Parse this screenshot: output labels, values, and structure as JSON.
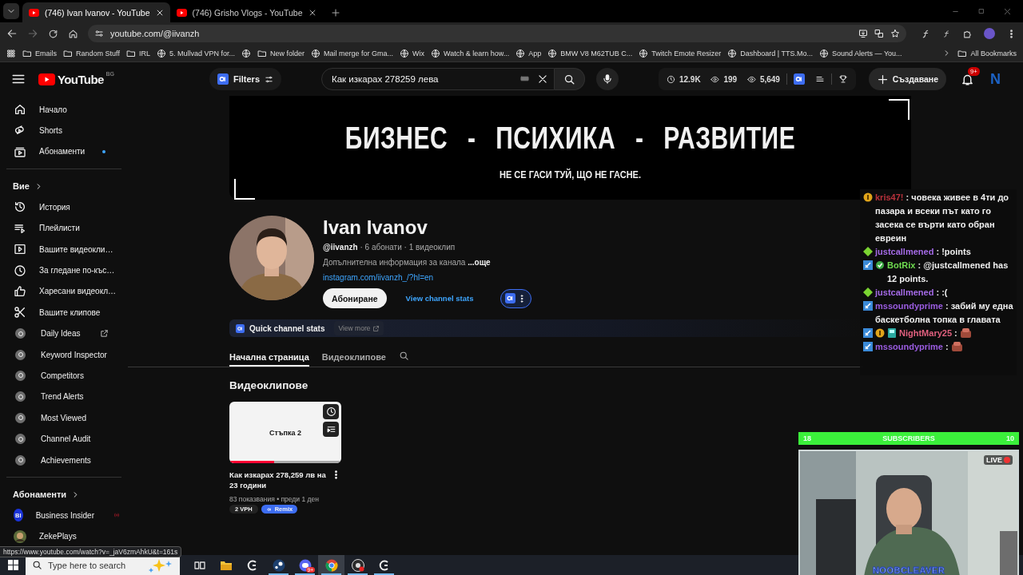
{
  "browser": {
    "tabs": [
      {
        "title": "(746) Ivan Ivanov - YouTube",
        "selected": true
      },
      {
        "title": "(746) Grisho Vlogs - YouTube",
        "selected": false
      }
    ],
    "url": "youtube.com/@iivanzh",
    "bookmarks": [
      {
        "kind": "folder",
        "label": "Emails"
      },
      {
        "kind": "folder",
        "label": "Random Stuff"
      },
      {
        "kind": "folder",
        "label": "IRL"
      },
      {
        "kind": "site",
        "label": "5. Mullvad VPN for..."
      },
      {
        "kind": "site"
      },
      {
        "kind": "folder",
        "label": "New folder"
      },
      {
        "kind": "site",
        "label": "Mail merge for Gma..."
      },
      {
        "kind": "site",
        "label": "Wix"
      },
      {
        "kind": "site",
        "label": "Watch & learn how..."
      },
      {
        "kind": "site",
        "label": "App"
      },
      {
        "kind": "site",
        "label": "BMW V8 M62TUB C..."
      },
      {
        "kind": "site",
        "label": "Twitch Emote Resizer"
      },
      {
        "kind": "site",
        "label": "Dashboard | TTS.Mo..."
      },
      {
        "kind": "site",
        "label": "Sound Alerts — You..."
      }
    ],
    "all_bookmarks": "All Bookmarks"
  },
  "header": {
    "logo": "YouTube",
    "region": "BG",
    "filters": "Filters",
    "search": {
      "value": "Как изкарах 278259 лева"
    },
    "stats": [
      "12.9K",
      "199",
      "5,649"
    ],
    "create": "Създаване",
    "notifications": "9+",
    "account": "N"
  },
  "sidebar": {
    "main": [
      {
        "label": "Начало",
        "new": false
      },
      {
        "label": "Shorts",
        "new": false
      },
      {
        "label": "Абонаменти",
        "new": true
      }
    ],
    "you": {
      "title": "Вие",
      "items": [
        {
          "kind": "nav",
          "label": "История",
          "external": false
        },
        {
          "kind": "nav",
          "label": "Плейлисти",
          "external": false
        },
        {
          "kind": "nav",
          "label": "Вашите видеокли…",
          "external": false
        },
        {
          "kind": "nav",
          "label": "За гледане по-къс…",
          "external": false
        },
        {
          "kind": "nav",
          "label": "Харесани видеокл…",
          "external": false
        },
        {
          "kind": "nav",
          "label": "Вашите клипове",
          "external": false
        },
        {
          "kind": "tool",
          "label": "Daily Ideas",
          "external": true
        },
        {
          "kind": "tool",
          "label": "Keyword Inspector",
          "external": false
        },
        {
          "kind": "tool",
          "label": "Competitors",
          "external": false
        },
        {
          "kind": "tool",
          "label": "Trend Alerts",
          "external": false
        },
        {
          "kind": "tool",
          "label": "Most Viewed",
          "external": false
        },
        {
          "kind": "tool",
          "label": "Channel Audit",
          "external": false
        },
        {
          "kind": "tool",
          "label": "Achievements",
          "external": false
        }
      ]
    },
    "subscriptions": {
      "title": "Абонаменти",
      "channels": [
        {
          "name": "Business Insider",
          "initials": "BI",
          "live": true
        },
        {
          "name": "ZekePlays",
          "live": false
        }
      ]
    }
  },
  "channel": {
    "banner": {
      "title": "БИЗНЕС - ПСИХИКА - РАЗВИТИЕ",
      "subtitle": "НЕ СЕ ГАСИ ТУЙ, ЩО НЕ ГАСНЕ."
    },
    "name": "Ivan Ivanov",
    "handle": "@iivanzh",
    "meta": "· 6 абонати · 1 видеоклип",
    "description": "Допълнителна информация за канала",
    "more": "...още",
    "link": "instagram.com/iivanzh_/?hl=en",
    "subscribe": "Абониране",
    "stats_link": "View channel stats",
    "quick_stats": "Quick channel stats",
    "view_more": "View more",
    "tabs": [
      {
        "label": "Начална страница",
        "selected": true
      },
      {
        "label": "Видеоклипове",
        "selected": false
      }
    ],
    "section_title": "Видеоклипове",
    "videos": [
      {
        "thumbnail_text": "Стъпка 2",
        "level": 0.4,
        "title": "Как изкарах 278,259 лв на 23 години",
        "meta": "83 показвания • преди 1 ден",
        "vph": "2 VPH",
        "remix": "Remix"
      }
    ]
  },
  "chat": {
    "messages": [
      {
        "badges": [
          {
            "kind": "coin"
          }
        ],
        "user": "kris47!",
        "color": "#b8323c",
        "text": ": човека живее в 4ти до пазара и всеки път като го засека се върти като обран евреин",
        "emote": false
      },
      {
        "badges": [
          {
            "kind": "gem"
          }
        ],
        "user": "justcallmened",
        "color": "#a56be8",
        "text": ": !points",
        "emote": false
      },
      {
        "badges": [
          {
            "kind": "mod"
          },
          {
            "kind": "verified"
          }
        ],
        "user": "BotRix",
        "color": "#6fdc50",
        "text": ": @justcallmened has 12 points.",
        "emote": false
      },
      {
        "badges": [
          {
            "kind": "gem"
          }
        ],
        "user": "justcallmened",
        "color": "#a56be8",
        "text": ": :(",
        "emote": false
      },
      {
        "badges": [
          {
            "kind": "mod"
          }
        ],
        "user": "mssoundyprime",
        "color": "#9a5ce0",
        "text": ": забий му една баскетболна топка в главата",
        "emote": false
      },
      {
        "badges": [
          {
            "kind": "mod"
          },
          {
            "kind": "coin"
          },
          {
            "kind": "tile"
          }
        ],
        "user": "NightMary25",
        "color": "#e0607e",
        "text": ":",
        "emote": true
      },
      {
        "badges": [
          {
            "kind": "mod"
          }
        ],
        "user": "mssoundyprime",
        "color": "#9a5ce0",
        "text": ":",
        "emote": true
      }
    ]
  },
  "stream": {
    "goal": {
      "current": "18",
      "label": "SUBSCRIBERS",
      "target": "10"
    },
    "live": "LIVE",
    "name": "NOOBCLEAVER"
  },
  "status_url": "https://www.youtube.com/watch?v=_jaV6zmAhkU&t=161s",
  "taskbar": {
    "search_placeholder": "Type here to search",
    "apps": [
      {
        "kind": "taskview",
        "running": false,
        "selected": false
      },
      {
        "kind": "explorer",
        "running": false,
        "selected": false
      },
      {
        "kind": "arc",
        "running": false,
        "selected": false
      },
      {
        "kind": "steam",
        "running": true,
        "selected": false
      },
      {
        "kind": "discord",
        "running": true,
        "selected": false,
        "badge": "9+"
      },
      {
        "kind": "chrome",
        "running": true,
        "selected": true
      },
      {
        "kind": "obs",
        "running": true,
        "selected": false
      },
      {
        "kind": "arc",
        "running": true,
        "selected": false
      }
    ]
  }
}
